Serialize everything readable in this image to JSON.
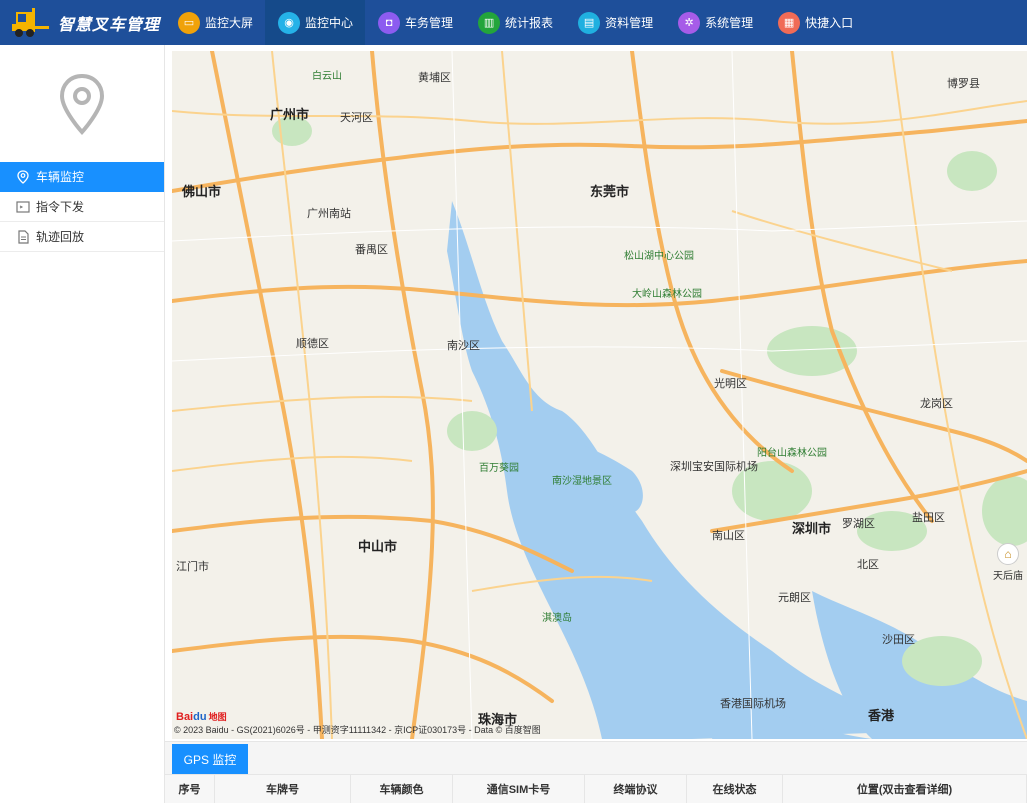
{
  "header": {
    "title": "智慧叉车管理",
    "nav": [
      {
        "label": "监控大屏",
        "icon": "monitor-screen-icon",
        "color": "#f0a20a",
        "glyph": "▭",
        "active": false
      },
      {
        "label": "监控中心",
        "icon": "location-pin-icon",
        "color": "#25b2e8",
        "glyph": "◉",
        "active": true
      },
      {
        "label": "车务管理",
        "icon": "car-icon",
        "color": "#8c5cf0",
        "glyph": "◘",
        "active": false
      },
      {
        "label": "统计报表",
        "icon": "bar-chart-icon",
        "color": "#23a53b",
        "glyph": "▥",
        "active": false
      },
      {
        "label": "资料管理",
        "icon": "document-icon",
        "color": "#20b0e0",
        "glyph": "▤",
        "active": false
      },
      {
        "label": "系统管理",
        "icon": "gear-icon",
        "color": "#a65ce8",
        "glyph": "✲",
        "active": false
      },
      {
        "label": "快捷入口",
        "icon": "grid-icon",
        "color": "#f06b56",
        "glyph": "▦",
        "active": false
      }
    ]
  },
  "sidebar": {
    "items": [
      {
        "label": "车辆监控",
        "icon": "location-pin-icon",
        "active": true
      },
      {
        "label": "指令下发",
        "icon": "command-icon",
        "active": false
      },
      {
        "label": "轨迹回放",
        "icon": "document-icon",
        "active": false
      }
    ]
  },
  "map": {
    "labels": {
      "guangzhou": "广州市",
      "foshan": "佛山市",
      "dongguan": "东莞市",
      "shenzhen": "深圳市",
      "zhongshan": "中山市",
      "zhuhai": "珠海市",
      "hongkong": "香港",
      "panyu": "番禺区",
      "nansha": "南沙区",
      "shunde": "顺德区",
      "guangming": "光明区",
      "longgang": "龙岗区",
      "nanshan": "南山区",
      "tianhe": "天河区",
      "huangpu": "黄埔区",
      "boluo": "博罗县",
      "yuanlang": "元朗区",
      "dapeng": "盐田区",
      "luohu": "罗湖区",
      "north": "北区",
      "shatian": "沙田区",
      "jiangmen": "江门市",
      "tianhou": "天后庙",
      "baiyun": "白云山",
      "songshan": "松山湖中心公园",
      "dalingshan": "大岭山森林公园",
      "yangtai": "阳台山森林公园",
      "neilingding": "淇澳岛",
      "xiangsha": "南沙湿地景区",
      "baima": "百万葵园",
      "airport": "深圳宝安国际机场",
      "hkairport": "香港国际机场",
      "stations": "广州南站"
    },
    "copyright": "© 2023 Baidu - GS(2021)6026号 - 甲测资字11111342 - 京ICP证030173号 - Data © 百度智图",
    "logo": "Bai du 地图"
  },
  "panel": {
    "tab": "GPS 监控",
    "columns": [
      "序号",
      "车牌号",
      "车辆颜色",
      "通信SIM卡号",
      "终端协议",
      "在线状态",
      "位置(双击查看详细)"
    ]
  }
}
